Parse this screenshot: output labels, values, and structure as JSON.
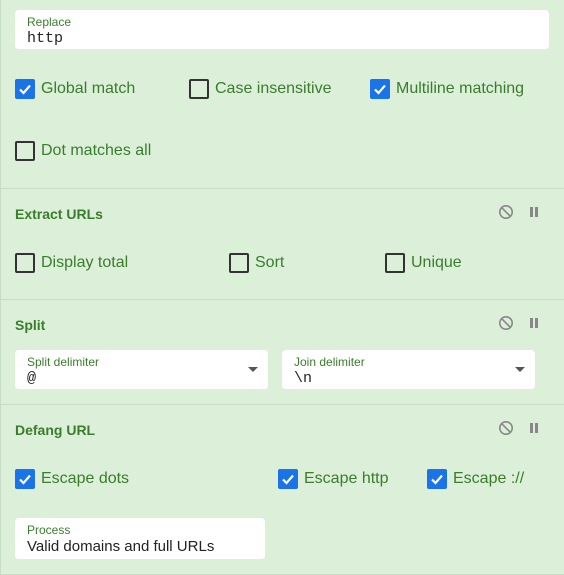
{
  "regex": {
    "replace_label": "Replace",
    "replace_value": "http",
    "checkboxes": [
      {
        "label": "Global match",
        "checked": true
      },
      {
        "label": "Case insensitive",
        "checked": false
      },
      {
        "label": "Multiline matching",
        "checked": true
      },
      {
        "label": "Dot matches all",
        "checked": false
      }
    ]
  },
  "extract_urls": {
    "title": "Extract URLs",
    "checkboxes": [
      {
        "label": "Display total",
        "checked": false
      },
      {
        "label": "Sort",
        "checked": false
      },
      {
        "label": "Unique",
        "checked": false
      }
    ]
  },
  "split": {
    "title": "Split",
    "split_delimiter_label": "Split delimiter",
    "split_delimiter_value": "@",
    "join_delimiter_label": "Join delimiter",
    "join_delimiter_value": "\\n"
  },
  "defang": {
    "title": "Defang URL",
    "checkboxes": [
      {
        "label": "Escape dots",
        "checked": true
      },
      {
        "label": "Escape http",
        "checked": true
      },
      {
        "label": "Escape ://",
        "checked": true
      }
    ],
    "process_label": "Process",
    "process_value": "Valid domains and full URLs"
  },
  "icons": {
    "disable": "disable-icon",
    "pause": "pause-icon"
  },
  "colors": {
    "panel_bg": "#dcefd9",
    "accent_green": "#3a7d2c",
    "checkbox_blue": "#1a73e8"
  }
}
